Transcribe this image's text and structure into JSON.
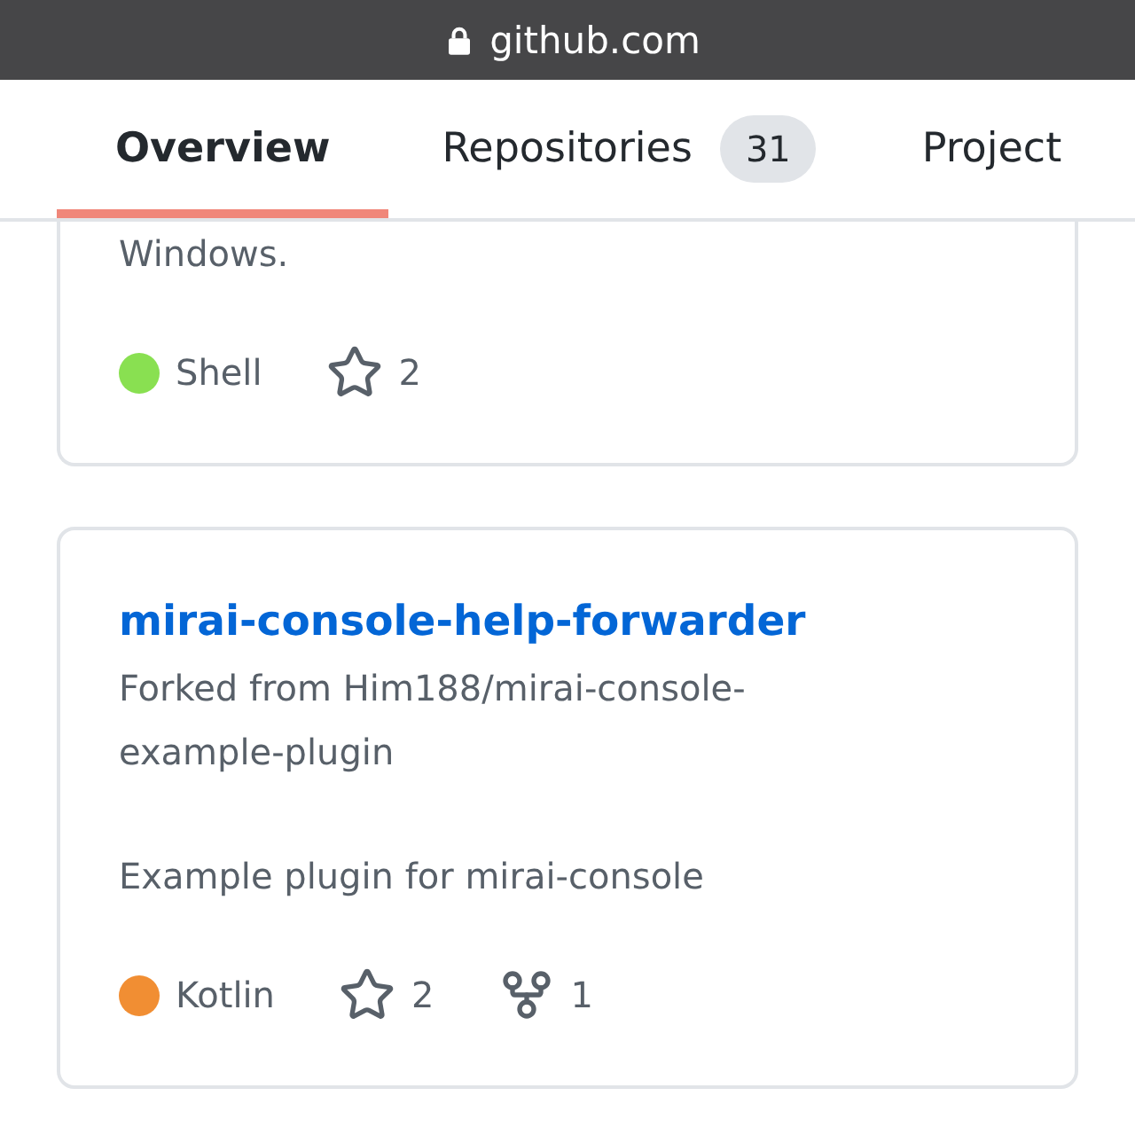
{
  "browser": {
    "url": "github.com"
  },
  "tabs": [
    {
      "label": "Overview",
      "selected": true
    },
    {
      "label": "Repositories",
      "counter": "31",
      "selected": false
    },
    {
      "label": "Project",
      "selected": false
    }
  ],
  "repositories": [
    {
      "description": "Windows.",
      "language": {
        "name": "Shell",
        "color": "#89e051"
      },
      "star_count": "2"
    },
    {
      "name": "mirai-console-help-forwarder",
      "forked_from": "Forked from Him188/mirai-console-example-plugin",
      "description": "Example plugin for mirai-console",
      "language": {
        "name": "Kotlin",
        "color": "#f18e33"
      },
      "star_count": "2",
      "fork_count": "1"
    }
  ]
}
